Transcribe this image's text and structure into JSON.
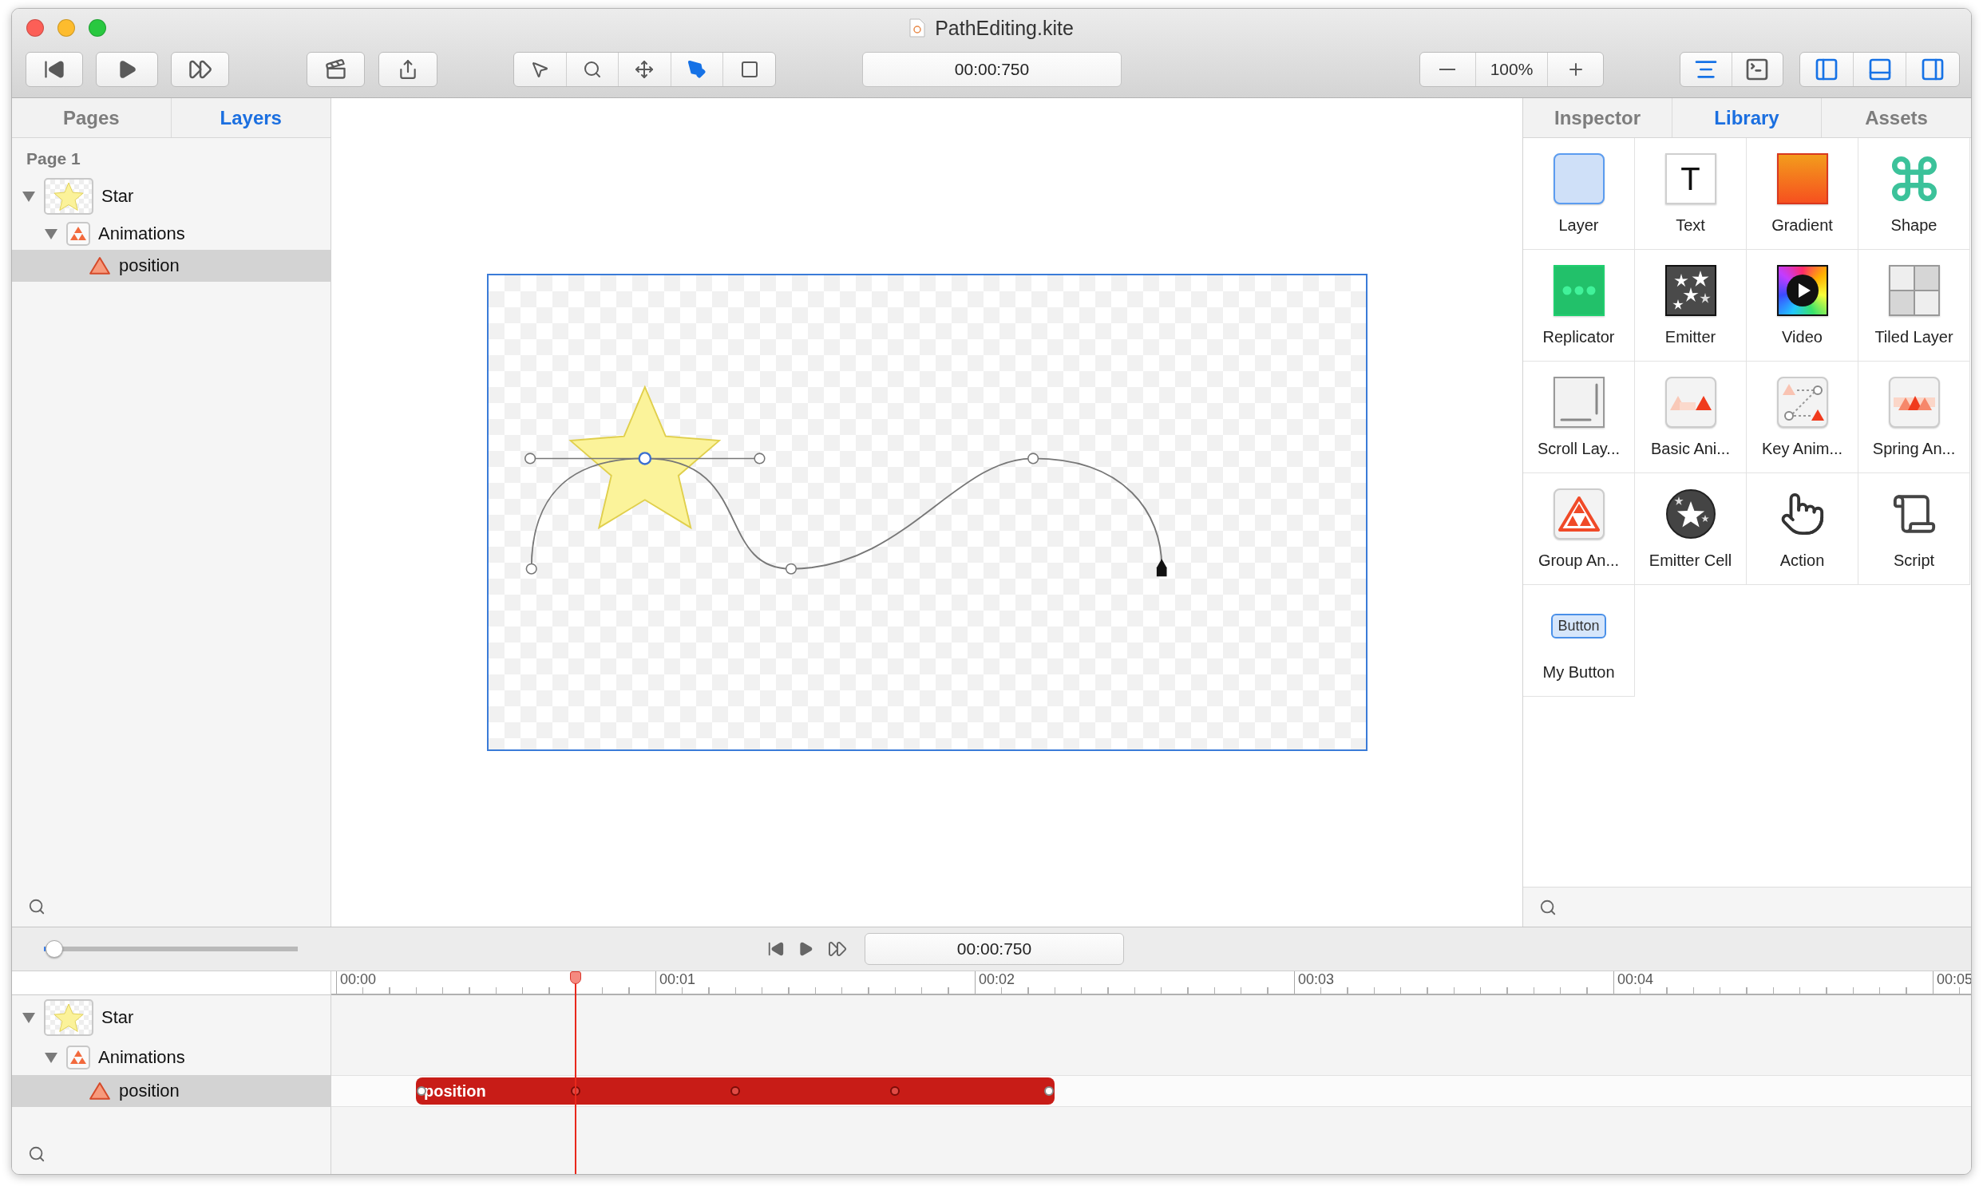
{
  "window": {
    "title": "PathEditing.kite"
  },
  "toolbar": {
    "tools": [
      {
        "kind": "pointer",
        "selected": false
      },
      {
        "kind": "zoom",
        "selected": false
      },
      {
        "kind": "move",
        "selected": false
      },
      {
        "kind": "pen",
        "selected": true
      },
      {
        "kind": "shape",
        "selected": false
      }
    ],
    "time": "00:00:750",
    "zoom": "100%",
    "views": [
      {
        "kind": "canvas",
        "on": true
      },
      {
        "kind": "console",
        "on": false
      }
    ],
    "panels": [
      {
        "kind": "left",
        "on": true
      },
      {
        "kind": "bottom",
        "on": true
      },
      {
        "kind": "right",
        "on": true
      }
    ]
  },
  "left_panel": {
    "tabs": [
      {
        "label": "Pages",
        "selected": false
      },
      {
        "label": "Layers",
        "selected": true
      }
    ],
    "page": "Page 1",
    "layers": [
      {
        "name": "Star",
        "kind": "layer",
        "expanded": true,
        "selected": false,
        "children": [
          {
            "name": "Animations",
            "kind": "group",
            "expanded": true,
            "selected": false,
            "children": [
              {
                "name": "position",
                "kind": "animation",
                "selected": true
              }
            ]
          }
        ]
      }
    ]
  },
  "right_panel": {
    "tabs": [
      {
        "label": "Inspector",
        "selected": false
      },
      {
        "label": "Library",
        "selected": true
      },
      {
        "label": "Assets",
        "selected": false
      }
    ],
    "library": [
      {
        "name": "Layer",
        "kind": "layer"
      },
      {
        "name": "Text",
        "kind": "text",
        "icon_text": "T"
      },
      {
        "name": "Gradient",
        "kind": "gradient"
      },
      {
        "name": "Shape",
        "kind": "shape"
      },
      {
        "name": "Replicator",
        "kind": "replicator"
      },
      {
        "name": "Emitter",
        "kind": "emitter"
      },
      {
        "name": "Video",
        "kind": "video"
      },
      {
        "name": "Tiled Layer",
        "kind": "tiled"
      },
      {
        "name": "Scroll Lay...",
        "kind": "scroll"
      },
      {
        "name": "Basic Ani...",
        "kind": "basic"
      },
      {
        "name": "Key Anim...",
        "kind": "keyframe"
      },
      {
        "name": "Spring An...",
        "kind": "spring"
      },
      {
        "name": "Group An...",
        "kind": "group"
      },
      {
        "name": "Emitter Cell",
        "kind": "emittercell"
      },
      {
        "name": "Action",
        "kind": "action"
      },
      {
        "name": "Script",
        "kind": "script"
      },
      {
        "name": "My Button",
        "kind": "button",
        "icon_text": "Button"
      }
    ]
  },
  "timeline": {
    "zoom_slider": {
      "level": 0.04
    },
    "time": "00:00:750",
    "ruler": [
      "00:00",
      "00:01",
      "00:02",
      "00:03",
      "00:04",
      "00:05"
    ],
    "tracks": [
      {
        "name": "Star",
        "kind": "layer",
        "expanded": true,
        "selected": false,
        "children": [
          {
            "name": "Animations",
            "kind": "group",
            "expanded": true,
            "selected": false,
            "children": [
              {
                "name": "position",
                "kind": "animation",
                "selected": true,
                "clip": "position"
              }
            ]
          }
        ]
      }
    ]
  }
}
